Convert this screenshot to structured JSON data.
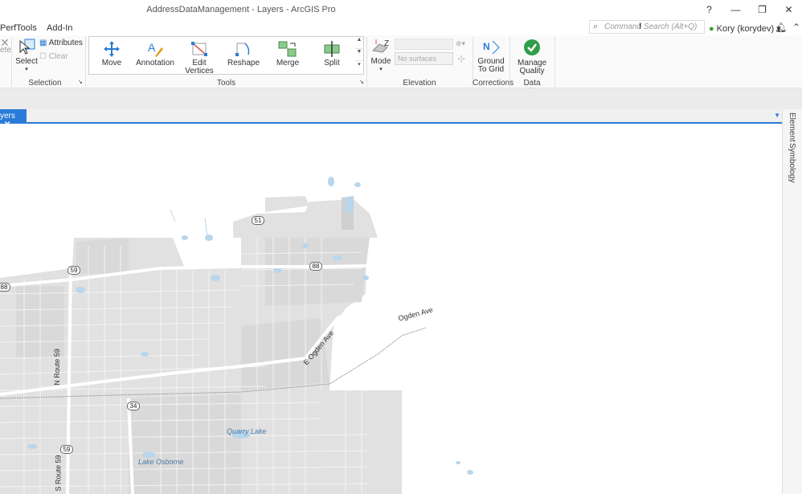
{
  "window": {
    "title": "AddressDataManagement - Layers - ArcGIS Pro",
    "help": "?",
    "minimize": "—",
    "restore": "❐",
    "close": "✕"
  },
  "tabs": [
    "PerfTools",
    "Add-In"
  ],
  "search": {
    "placeholder": "Command Search (Alt+Q)"
  },
  "user": {
    "name": "Kory (korydev)"
  },
  "ribbon": {
    "selection": {
      "label": "Selection",
      "select": "Select",
      "attributes": "Attributes",
      "clear": "Clear",
      "partial": "ete"
    },
    "tools": {
      "label": "Tools",
      "items": [
        "Move",
        "Annotation",
        "Edit Vertices",
        "Reshape",
        "Merge",
        "Split"
      ]
    },
    "elevation": {
      "label": "Elevation",
      "mode": "Mode",
      "surfaces": "No surfaces"
    },
    "corrections": {
      "label": "Corrections",
      "ground": "Ground To Grid"
    },
    "reviewer": {
      "label": "Data Reviewer",
      "manage": "Manage Quality"
    }
  },
  "doc_tab": {
    "label": "yers",
    "close": "✕"
  },
  "side_tabs": [
    "Element",
    "Symbology"
  ],
  "map": {
    "roads": [
      "Ogden Ave",
      "E Ogden Ave",
      "N Route 59",
      "S Route 59"
    ],
    "lakes": [
      "Quarry Lake",
      "Lake Osborne"
    ],
    "shields": [
      "51",
      "88",
      "59",
      "88",
      "34",
      "59"
    ]
  }
}
